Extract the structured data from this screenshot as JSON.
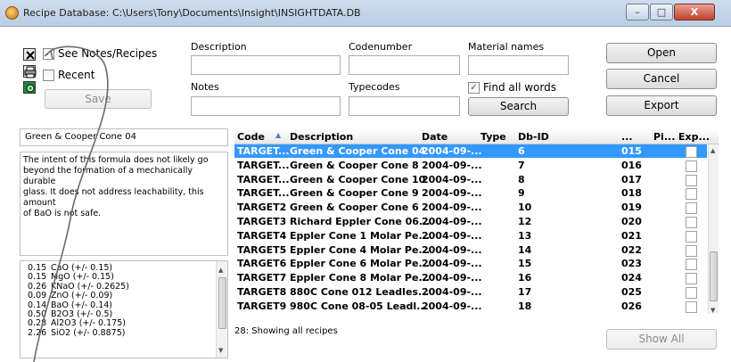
{
  "window": {
    "title": "Recipe Database: C:\\Users\\Tony\\Documents\\Insight\\INSIGHTDATA.DB",
    "minimize": "–",
    "maximize": "□",
    "close": "X"
  },
  "options": {
    "see_notes_label": "See Notes/Recipes",
    "see_notes_checked": "✓",
    "recent_label": "Recent",
    "save_label": "Save"
  },
  "filters": {
    "description_label": "Description",
    "codenumber_label": "Codenumber",
    "material_names_label": "Material names",
    "notes_label": "Notes",
    "typecodes_label": "Typecodes",
    "find_all_words_label": "Find all words",
    "find_all_words_checked": "✓",
    "search_label": "Search",
    "description_value": "",
    "codenumber_value": "",
    "material_names_value": "",
    "notes_value": "",
    "typecodes_value": ""
  },
  "actions": {
    "open_label": "Open",
    "cancel_label": "Cancel",
    "export_label": "Export",
    "show_all_label": "Show All"
  },
  "detail": {
    "recipe_name": "Green & Cooper Cone 04",
    "notes_lines": [
      "The intent of this formula does not likely go",
      "beyond the formation of a mechanically durable",
      "glass. It does not address leachability, this amount",
      "of BaO is not safe."
    ],
    "oxides": [
      {
        "amount": "0.15",
        "formula": "CaO (+/- 0.15)"
      },
      {
        "amount": "0.15",
        "formula": "MgO (+/- 0.15)"
      },
      {
        "amount": "0.26",
        "formula": "KNaO (+/- 0.2625)"
      },
      {
        "amount": "0.09",
        "formula": "ZnO (+/- 0.09)"
      },
      {
        "amount": "0.14",
        "formula": "BaO (+/- 0.14)"
      },
      {
        "amount": "0.50",
        "formula": "B2O3 (+/- 0.5)"
      },
      {
        "amount": "0.28",
        "formula": "Al2O3 (+/- 0.175)"
      },
      {
        "amount": "2.26",
        "formula": "SiO2 (+/- 0.8875)"
      }
    ]
  },
  "grid": {
    "columns": [
      "Code",
      "Description",
      "Date",
      "Type",
      "Db-ID",
      "...",
      "Pi...",
      "Exp..."
    ],
    "rows": [
      {
        "code": "TARGET...",
        "description": "Green & Cooper Cone 04",
        "date": "2004-09-...",
        "type": "",
        "dbid": "6",
        "num": "015",
        "pi": "",
        "selected": true
      },
      {
        "code": "TARGET...",
        "description": "Green & Cooper Cone 8",
        "date": "2004-09-...",
        "type": "",
        "dbid": "7",
        "num": "016",
        "pi": "",
        "selected": false
      },
      {
        "code": "TARGET...",
        "description": "Green & Cooper Cone 10",
        "date": "2004-09-...",
        "type": "",
        "dbid": "8",
        "num": "017",
        "pi": "",
        "selected": false
      },
      {
        "code": "TARGET...",
        "description": "Green & Cooper Cone 9",
        "date": "2004-09-...",
        "type": "",
        "dbid": "9",
        "num": "018",
        "pi": "",
        "selected": false
      },
      {
        "code": "TARGET2",
        "description": "Green & Cooper Cone 6",
        "date": "2004-09-...",
        "type": "",
        "dbid": "10",
        "num": "019",
        "pi": "",
        "selected": false
      },
      {
        "code": "TARGET3",
        "description": "Richard Eppler Cone 06...",
        "date": "2004-09-...",
        "type": "",
        "dbid": "12",
        "num": "020",
        "pi": "",
        "selected": false
      },
      {
        "code": "TARGET4",
        "description": "Eppler Cone 1 Molar Pe...",
        "date": "2004-09-...",
        "type": "",
        "dbid": "13",
        "num": "021",
        "pi": "",
        "selected": false
      },
      {
        "code": "TARGET5",
        "description": "Eppler Cone 4 Molar Pe...",
        "date": "2004-09-...",
        "type": "",
        "dbid": "14",
        "num": "022",
        "pi": "",
        "selected": false
      },
      {
        "code": "TARGET6",
        "description": "Eppler Cone 6 Molar Pe...",
        "date": "2004-09-...",
        "type": "",
        "dbid": "15",
        "num": "023",
        "pi": "",
        "selected": false
      },
      {
        "code": "TARGET7",
        "description": "Eppler Cone 8 Molar Pe...",
        "date": "2004-09-...",
        "type": "",
        "dbid": "16",
        "num": "024",
        "pi": "",
        "selected": false
      },
      {
        "code": "TARGET8",
        "description": "880C Cone 012 Leadles...",
        "date": "2004-09-...",
        "type": "",
        "dbid": "17",
        "num": "025",
        "pi": "",
        "selected": false
      },
      {
        "code": "TARGET9",
        "description": "980C Cone 08-05 Leadl...",
        "date": "2004-09-...",
        "type": "",
        "dbid": "18",
        "num": "026",
        "pi": "",
        "selected": false
      }
    ],
    "status": "28: Showing all recipes"
  },
  "colors": {
    "selection": "#3399ff",
    "annotation_arrow": "#6b6b6b"
  }
}
